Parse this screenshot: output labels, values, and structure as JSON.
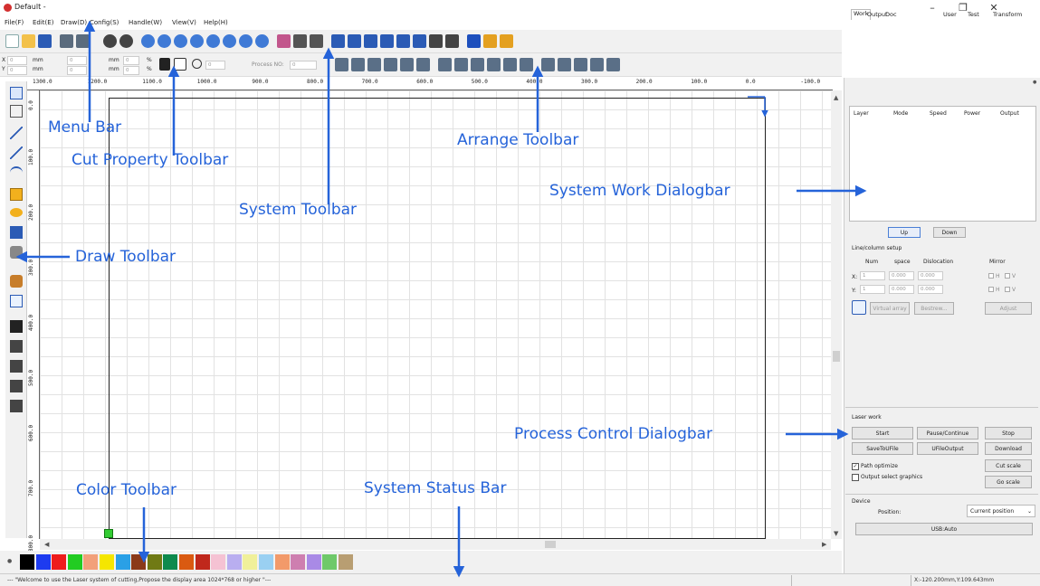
{
  "window": {
    "title": "Default -",
    "controls": [
      "–",
      "❐",
      "✕"
    ]
  },
  "menu": {
    "items": [
      "File(F)",
      "Edit(E)",
      "Draw(D)",
      "Config(S)",
      "Handle(W)",
      "View(V)",
      "Help(H)"
    ]
  },
  "cut_property": {
    "x_label": "X",
    "y_label": "Y",
    "x_value": "0",
    "y_value": "0",
    "w_value": "0",
    "h_value": "0",
    "unit_mm": "mm",
    "percent": "%",
    "rotate_value": "0",
    "process_no_label": "Process NO:",
    "process_no_value": "0"
  },
  "ruler": {
    "top_ticks": [
      "1300.0",
      "1200.0",
      "1100.0",
      "1000.0",
      "900.0",
      "800.0",
      "700.0",
      "600.0",
      "500.0",
      "400.0",
      "300.0",
      "200.0",
      "100.0",
      "0.0",
      "-100.0"
    ],
    "left_ticks": [
      "0.0",
      "100.0",
      "200.0",
      "300.0",
      "400.0",
      "500.0",
      "600.0",
      "700.0",
      "800.0"
    ]
  },
  "panel": {
    "tabs": [
      "Work",
      "Output",
      "Doc",
      "User",
      "Test",
      "Transform"
    ],
    "grid_columns": [
      "Layer",
      "Mode",
      "Speed",
      "Power",
      "Output"
    ],
    "up_label": "Up",
    "down_label": "Down",
    "line_column_title": "Line/column setup",
    "num_label": "Num",
    "space_label": "space",
    "dislocation_label": "Dislocation",
    "mirror_label": "Mirror",
    "x_row_label": "X:",
    "y_row_label": "Y:",
    "x_num": "1",
    "x_space": "0.000",
    "x_disloc": "0.000",
    "y_num": "1",
    "y_space": "0.000",
    "y_disloc": "0.000",
    "mirror_h": "H",
    "mirror_v": "V",
    "virtual_array_label": "Virtual array",
    "bestrew_label": "Bestrew...",
    "adjust_label": "Adjust",
    "laser_work_title": "Laser work",
    "start_label": "Start",
    "pause_label": "Pause/Continue",
    "stop_label": "Stop",
    "save_file_label": "SaveToUFile",
    "ufile_output_label": "UFileOutput",
    "download_label": "Download",
    "path_optimize_label": "Path optimize",
    "output_select_label": "Output select graphics",
    "cut_scale_label": "Cut scale",
    "go_scale_label": "Go scale",
    "device_title": "Device",
    "position_label": "Position:",
    "position_value": "Current position",
    "device_value": "USB:Auto"
  },
  "colors": {
    "palette": [
      "#000000",
      "#1d3bf0",
      "#ee1c1c",
      "#22cc22",
      "#f2a07a",
      "#f5e600",
      "#2aa0e6",
      "#8b3a1a",
      "#707a14",
      "#0f8a4d",
      "#da5a11",
      "#c0281c",
      "#f5c2d3",
      "#b9aef0",
      "#f0f09a",
      "#9ad0f2",
      "#f29a6a",
      "#ce7fb0",
      "#a98ae6",
      "#6fc96a",
      "#b89e72"
    ],
    "annotation": "#2563d9"
  },
  "status": {
    "message": "--- \"Welcome to use the Laser system of cutting,Propose the display area 1024*768 or higher \"---",
    "coords": "X:-120.200mm,Y:109.643mm"
  },
  "annotations": {
    "menu_bar": "Menu Bar",
    "cut_property_toolbar": "Cut Property Toolbar",
    "system_toolbar": "System Toolbar",
    "arrange_toolbar": "Arrange Toolbar",
    "system_work_dialogbar": "System Work Dialogbar",
    "draw_toolbar": "Draw Toolbar",
    "process_control_dialogbar": "Process Control Dialogbar",
    "color_toolbar": "Color Toolbar",
    "system_status_bar": "System Status Bar"
  }
}
